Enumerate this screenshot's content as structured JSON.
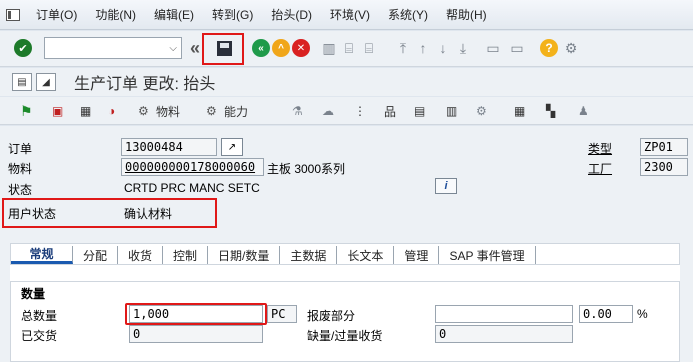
{
  "menu": [
    "订单(O)",
    "功能(N)",
    "编辑(E)",
    "转到(G)",
    "抬头(D)",
    "环境(V)",
    "系统(Y)",
    "帮助(H)"
  ],
  "title": "生产订单 更改: 抬头",
  "app_toolbar": {
    "material": "物料",
    "capacity": "能力"
  },
  "header": {
    "order_label": "订单",
    "order_value": "13000484",
    "material_label": "物料",
    "material_value": "000000000178000060",
    "material_desc": "主板 3000系列",
    "status_label": "状态",
    "status_value": "CRTD PRC  MANC SETC",
    "user_status_label": "用户状态",
    "user_status_value": "确认材料",
    "type_label": "类型",
    "type_value": "ZP01",
    "plant_label": "工厂",
    "plant_value": "2300",
    "info_icon": "i"
  },
  "tabs": [
    "常规",
    "分配",
    "收货",
    "控制",
    "日期/数量",
    "主数据",
    "长文本",
    "管理",
    "SAP 事件管理"
  ],
  "quantity": {
    "group_title": "数量",
    "total_label": "总数量",
    "total_value": "1,000",
    "unit": "PC",
    "delivered_label": "已交货",
    "delivered_value": "0",
    "scrap_label": "报废部分",
    "scrap_value": "",
    "scrap_pct": "0.00",
    "pct_sign": "%",
    "shortage_label": "缺量/过量收货",
    "shortage_value": "0"
  },
  "colors": {
    "accent": "#1a5ab0",
    "highlight": "#e01818"
  }
}
